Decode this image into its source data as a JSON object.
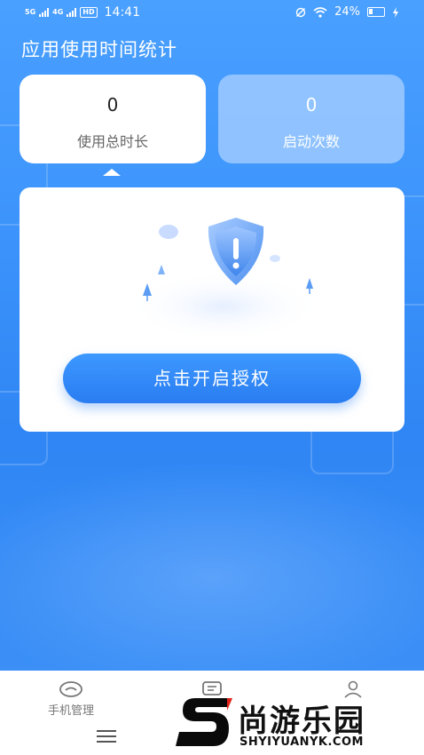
{
  "status_bar": {
    "network_a": "5G",
    "network_b": "4G",
    "hd": "HD",
    "time": "14:41",
    "battery": "24%"
  },
  "page": {
    "title": "应用使用时间统计"
  },
  "stats": [
    {
      "value": "0",
      "label": "使用总时长"
    },
    {
      "value": "0",
      "label": "启动次数"
    }
  ],
  "auth": {
    "button_label": "点击开启授权"
  },
  "bottom_nav": {
    "items": [
      {
        "label": "手机管理",
        "icon": "eye-icon"
      },
      {
        "label": "",
        "icon": "message-icon"
      },
      {
        "label": "",
        "icon": "user-icon"
      }
    ]
  },
  "watermark": {
    "brand": "尚游乐园",
    "url": "SHYIYUANYK.COM"
  },
  "colors": {
    "primary": "#3d93fb",
    "button": "#2f86f4"
  }
}
